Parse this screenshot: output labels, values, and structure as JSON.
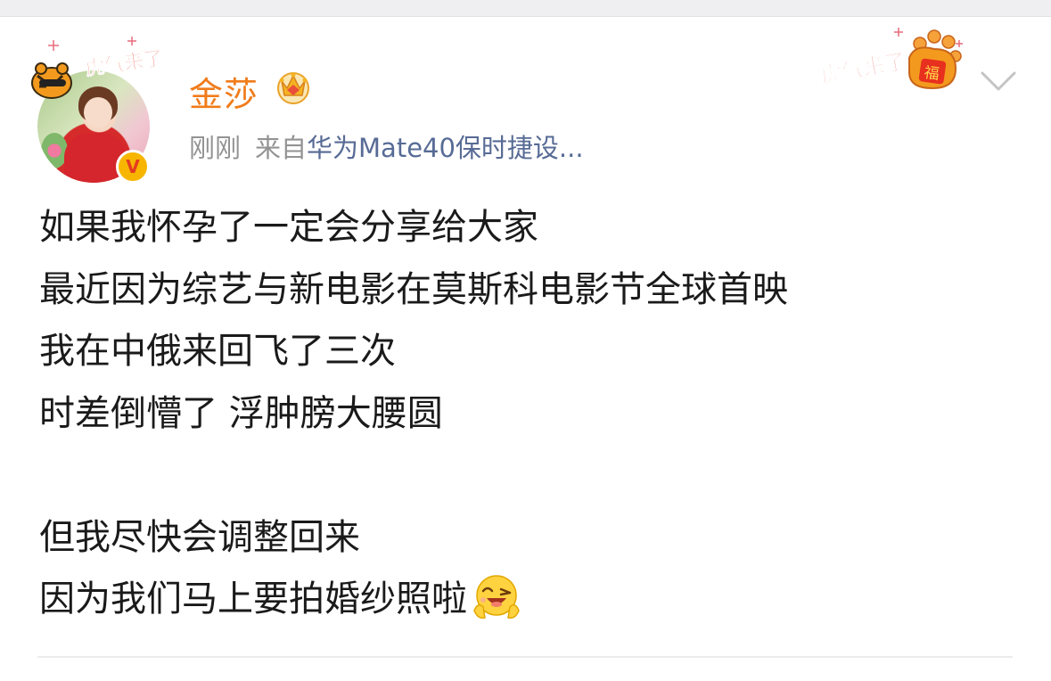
{
  "post": {
    "user": {
      "name": "金莎",
      "avatar_frame_text": "虎气来了",
      "verified_badge_letter": "V",
      "vip_icon": "crown-icon"
    },
    "meta": {
      "time": "刚刚",
      "source_prefix": "来自",
      "source_device": "华为Mate40保时捷设..."
    },
    "sticker_text": "虎气来了",
    "sticker_icon": "tiger-paw-fu-sticker-icon",
    "more_icon": "chevron-down-icon",
    "content_lines": [
      "如果我怀孕了一定会分享给大家",
      "最近因为综艺与新电影在莫斯科电影节全球首映",
      "我在中俄来回飞了三次",
      "时差倒懵了 浮肿膀大腰圆",
      "",
      "但我尽快会调整回来",
      "因为我们马上要拍婚纱照啦"
    ],
    "content_emoji": "laughing-wink-emoji-icon"
  },
  "colors": {
    "username": "#f07c1b",
    "meta_gray": "#939393",
    "link_blue": "#576b95",
    "body_text": "#1a1a1a",
    "badge_gold": "#f7b500",
    "badge_letter": "#e53b1f"
  }
}
